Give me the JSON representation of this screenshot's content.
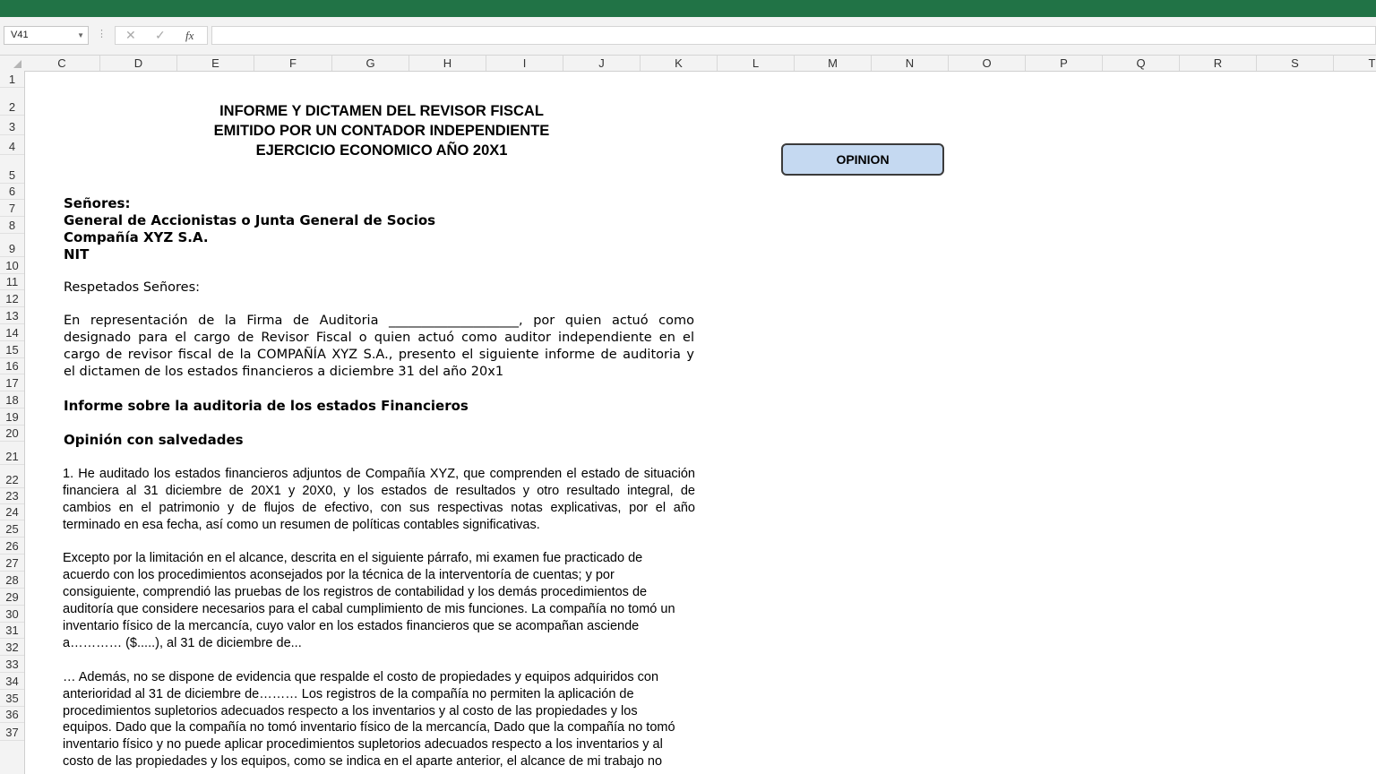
{
  "formula_bar": {
    "name_box": "V41",
    "cancel_symbol": "✕",
    "enter_symbol": "✓",
    "fx_symbol": "fx",
    "formula": ""
  },
  "columns": [
    "C",
    "D",
    "E",
    "F",
    "G",
    "H",
    "I",
    "J",
    "K",
    "L",
    "M",
    "N",
    "O",
    "P",
    "Q",
    "R",
    "S",
    "T"
  ],
  "rows": [
    "1",
    "2",
    "3",
    "4",
    "5",
    "6",
    "7",
    "8",
    "9",
    "10",
    "11",
    "12",
    "13",
    "14",
    "15",
    "16",
    "17",
    "18",
    "19",
    "20",
    "21",
    "22",
    "23",
    "24",
    "25",
    "26",
    "27",
    "28",
    "29",
    "30",
    "31",
    "32",
    "33",
    "34",
    "35",
    "36",
    "37"
  ],
  "button": {
    "label": "OPINION"
  },
  "document": {
    "title_lines": [
      "INFORME Y DICTAMEN DEL REVISOR FISCAL",
      "EMITIDO POR UN CONTADOR INDEPENDIENTE",
      "EJERCICIO ECONOMICO AÑO 20X1"
    ],
    "addressee": [
      "Señores:",
      "General de Accionistas o Junta General de Socios",
      "Compañía XYZ S.A.",
      "NIT"
    ],
    "greeting": "Respetados Señores:",
    "intro_lines": [
      "En representación de la Firma de Auditoria ____________________, por quien actuó como",
      "designado para el cargo de Revisor Fiscal o quien actuó como auditor independiente en el",
      "cargo de revisor fiscal de la COMPAÑÍA XYZ S.A., presento el siguiente informe de auditoria y",
      "el dictamen de los estados financieros a diciembre 31 del año 20x1"
    ],
    "section_heading": "Informe sobre la auditoria de los estados Financieros",
    "subsection_heading": "Opinión con salvedades",
    "para1_lines": [
      "1. He auditado los estados financieros adjuntos de Compañía XYZ, que comprenden el estado de situación",
      "financiera al 31 diciembre de 20X1 y 20X0, y los estados de resultados y otro resultado integral, de",
      "cambios en el patrimonio y de flujos de efectivo, con sus respectivas notas explicativas, por el año",
      "terminado en esa fecha, así como un resumen de políticas contables significativas."
    ],
    "para2_lines": [
      "Excepto por la limitación en el alcance, descrita en el siguiente párrafo, mi examen fue practicado de",
      "acuerdo con los procedimientos aconsejados por la técnica de la interventoría de cuentas; y por",
      "consiguiente, comprendió las pruebas de los registros de contabilidad y los demás procedimientos de",
      "auditoría que considere necesarios para el cabal cumplimiento de mis funciones. La compañía no tomó un",
      "inventario físico de la mercancía, cuyo valor en los estados financieros que se acompañan asciende",
      "a………… ($.....), al 31 de diciembre de..."
    ],
    "para3_lines": [
      "… Además, no se dispone de evidencia que respalde el costo de propiedades y equipos adquiridos con",
      "anterioridad al 31 de diciembre de……… Los registros de la compañía no permiten la aplicación de",
      "procedimientos supletorios adecuados respecto a los inventarios y al costo de las propiedades y los",
      "equipos. Dado que la compañía no tomó inventario físico de la mercancía, Dado que la compañía no tomó",
      "inventario físico y no puede aplicar procedimientos supletorios adecuados respecto a los inventarios y al",
      "costo de las propiedades y los equipos, como se indica en el aparte anterior, el alcance de mi trabajo no"
    ]
  }
}
